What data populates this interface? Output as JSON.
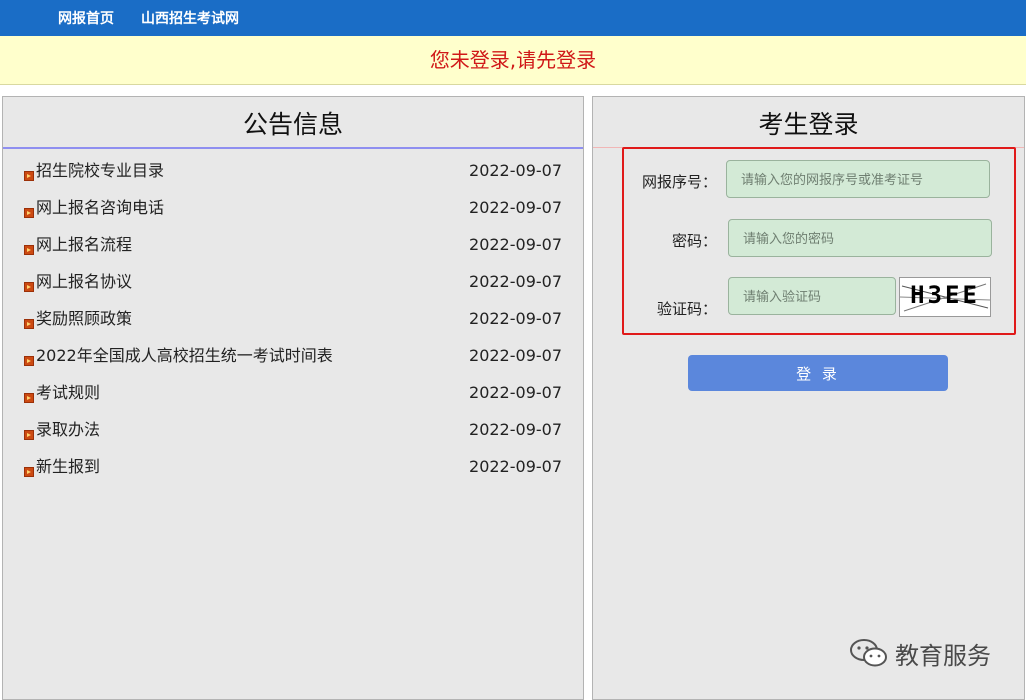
{
  "nav": {
    "home": "网报首页",
    "exam_site": "山西招生考试网"
  },
  "alert": "您未登录,请先登录",
  "announcements": {
    "title": "公告信息",
    "items": [
      {
        "title": "招生院校专业目录",
        "date": "2022-09-07"
      },
      {
        "title": "网上报名咨询电话",
        "date": "2022-09-07"
      },
      {
        "title": "网上报名流程",
        "date": "2022-09-07"
      },
      {
        "title": "网上报名协议",
        "date": "2022-09-07"
      },
      {
        "title": "奖励照顾政策",
        "date": "2022-09-07"
      },
      {
        "title": "2022年全国成人高校招生统一考试时间表",
        "date": "2022-09-07"
      },
      {
        "title": "考试规则",
        "date": "2022-09-07"
      },
      {
        "title": "录取办法",
        "date": "2022-09-07"
      },
      {
        "title": "新生报到",
        "date": "2022-09-07"
      }
    ]
  },
  "login": {
    "title": "考生登录",
    "reg_label": "网报序号：",
    "reg_placeholder": "请输入您的网报序号或准考证号",
    "password_label": "密码：",
    "password_placeholder": "请输入您的密码",
    "captcha_label": "验证码：",
    "captcha_placeholder": "请输入验证码",
    "captcha_text": "H3EE",
    "button": "登 录"
  },
  "watermark": "教育服务",
  "colors": {
    "nav_bg": "#1a6dc6",
    "alert_bg": "#ffffcc",
    "alert_text": "#d01818",
    "input_bg": "#d3ead6",
    "button_bg": "#5b87dc",
    "highlight_border": "#e01919"
  }
}
